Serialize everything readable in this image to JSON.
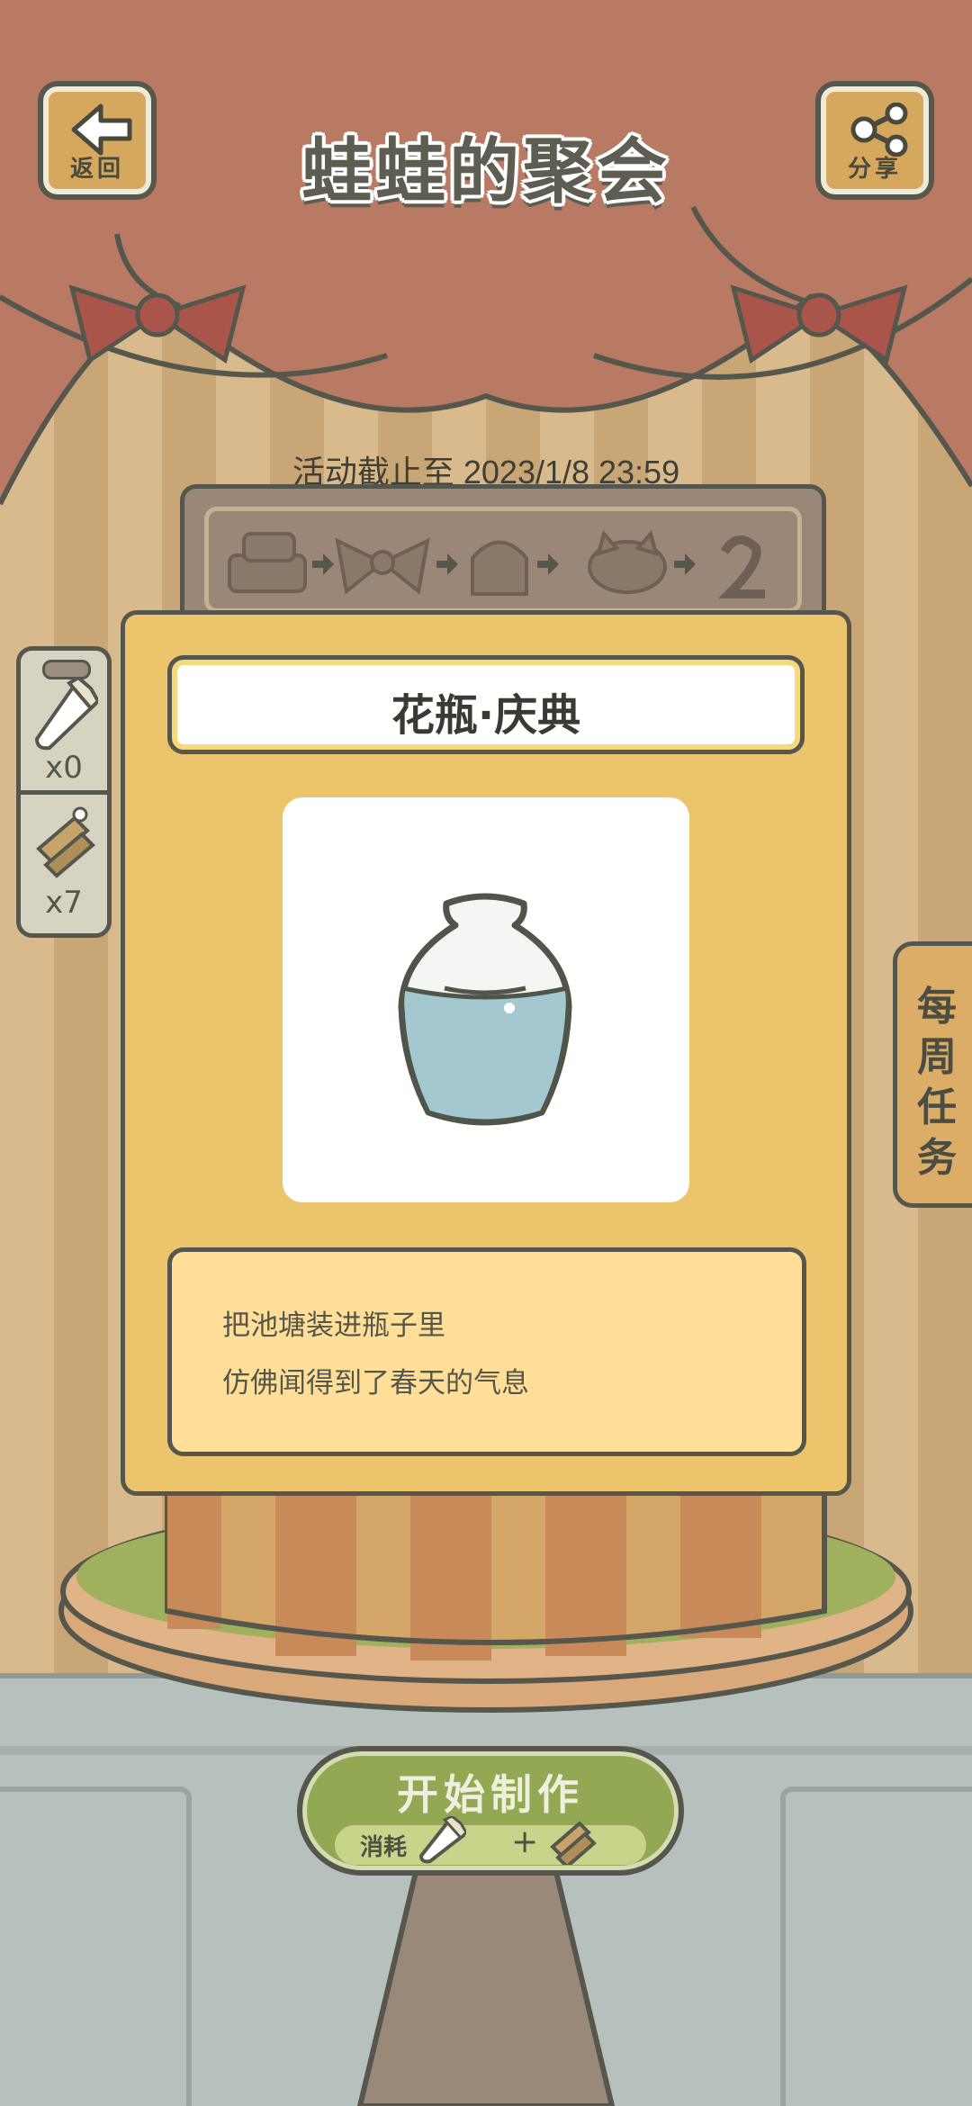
{
  "header": {
    "back_label": "返回",
    "title": "蛙蛙的聚会",
    "share_label": "分享"
  },
  "event": {
    "deadline": "活动截止至 2023/1/8 23:59"
  },
  "progress": {
    "steps": [
      "cake-base-icon",
      "ribbon-icon",
      "cream-icon",
      "cat-icon",
      "number-two-icon"
    ]
  },
  "inventory": {
    "items": [
      {
        "icon": "piping-bag-icon",
        "count": "x0"
      },
      {
        "icon": "tools-bundle-icon",
        "count": "x7"
      }
    ]
  },
  "item": {
    "name": "花瓶·庆典",
    "image": "vase-icon",
    "description_line1": "把池塘装进瓶子里",
    "description_line2": "仿佛闻得到了春天的气息"
  },
  "weekly_tasks": {
    "label": "每周任务"
  },
  "start_button": {
    "label": "开始制作",
    "cost_label": "消耗",
    "plus": "+"
  },
  "colors": {
    "curtain": "#b87a63",
    "wall_light": "#d8ba8c",
    "wall_dark": "#c9a676",
    "card": "#ecc46c",
    "button_green": "#93a852"
  }
}
